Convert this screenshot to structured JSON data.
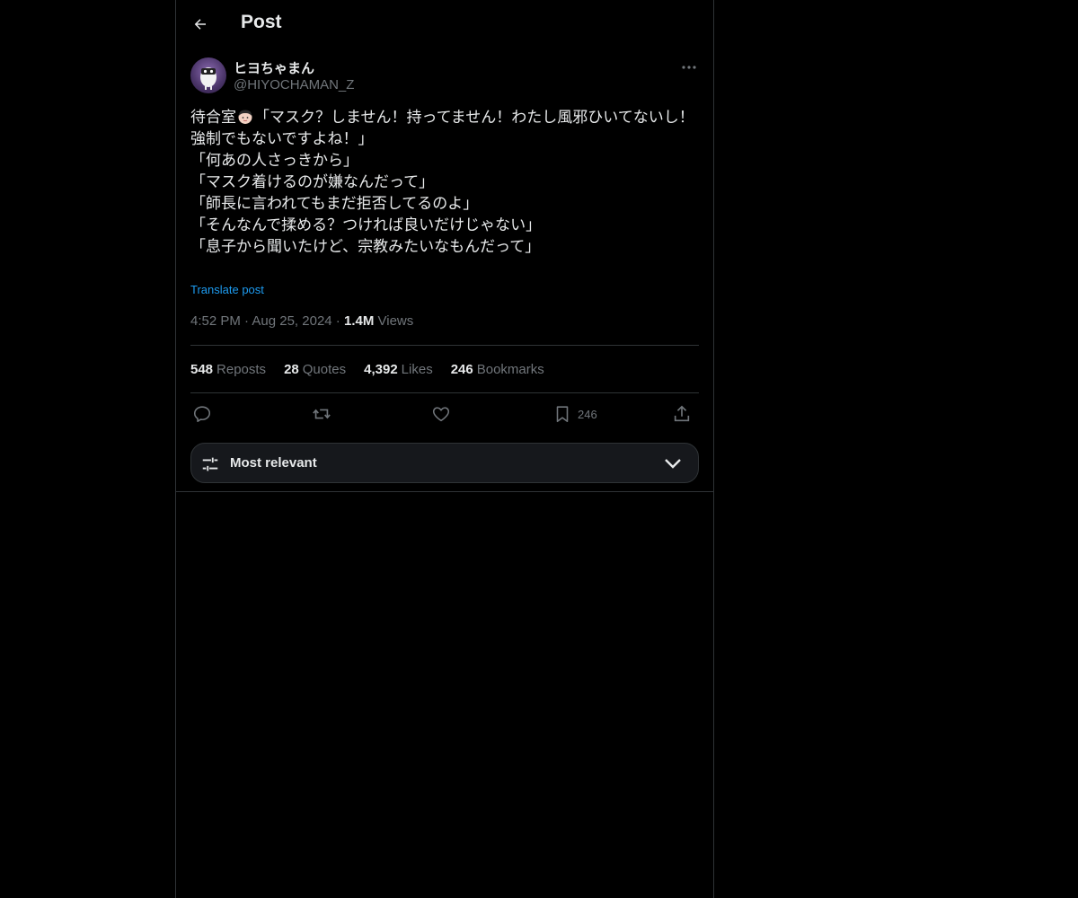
{
  "header": {
    "title": "Post",
    "back_icon": "arrow-left-icon"
  },
  "author": {
    "display_name": "ヒヨちゃまん",
    "handle": "@HIYOCHAMAN_Z"
  },
  "post": {
    "line1_prefix": "待合室",
    "line1_suffix": "「マスク？しません！持ってません！わたし風邪ひいてないし！強制でもないですよね！」",
    "body_rest": "\n「何あの人さっきから」\n「マスク着けるのが嫌なんだって」\n「師長に言われてもまだ拒否してるのよ」\n「そんなんで揉める？つければ良いだけじゃない」\n「息子から聞いたけど、宗教みたいなもんだって」",
    "translate": "Translate post"
  },
  "meta": {
    "time": "4:52 PM",
    "sep1": " · ",
    "date": "Aug 25, 2024",
    "sep2": " · ",
    "views_count": "1.4M",
    "views_label": "Views"
  },
  "stats": {
    "reposts_count": "548",
    "reposts_label": "Reposts",
    "quotes_count": "28",
    "quotes_label": "Quotes",
    "likes_count": "4,392",
    "likes_label": "Likes",
    "bookmarks_count": "246",
    "bookmarks_label": "Bookmarks"
  },
  "actions": {
    "bookmark_count": "246"
  },
  "sort": {
    "label": "Most relevant"
  },
  "colors": {
    "background": "#000000",
    "text": "#e7e9ea",
    "muted": "#71767b",
    "link": "#1d9bf0",
    "border": "#2f3336"
  }
}
